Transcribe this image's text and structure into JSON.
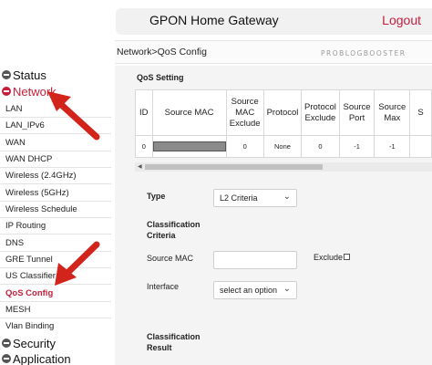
{
  "header": {
    "title": "GPON Home Gateway",
    "logout": "Logout"
  },
  "breadcrumb": "Network>QoS Config",
  "watermark": "PROBLOGBOOSTER",
  "sidebar": {
    "groups": {
      "status": "Status",
      "network": "Network",
      "security": "Security",
      "application": "Application"
    },
    "items": [
      "LAN",
      "LAN_IPv6",
      "WAN",
      "WAN DHCP",
      "Wireless (2.4GHz)",
      "Wireless (5GHz)",
      "Wireless Schedule",
      "IP Routing",
      "DNS",
      "GRE Tunnel",
      "US Classifier",
      "QoS Config",
      "MESH",
      "Vlan Binding"
    ],
    "active_item": "QoS Config"
  },
  "qos": {
    "section_title": "QoS Setting",
    "columns": [
      "ID",
      "Source MAC",
      "Source MAC Exclude",
      "Protocol",
      "Protocol Exclude",
      "Source Port",
      "Source Max",
      "S"
    ],
    "row": [
      "0",
      "",
      "0",
      "None",
      "0",
      "-1",
      "-1",
      ""
    ]
  },
  "form": {
    "type_label": "Type",
    "type_value": "L2 Criteria",
    "classification_criteria_label": "Classification Criteria",
    "source_mac_label": "Source MAC",
    "exclude_label": "Exclude",
    "interface_label": "Interface",
    "interface_value": "select an option",
    "classification_result_label": "Classification Result"
  },
  "colors": {
    "accent": "#c21f3a",
    "header_bg": "#f1f1f1",
    "content_bg": "#f4f4f4"
  }
}
